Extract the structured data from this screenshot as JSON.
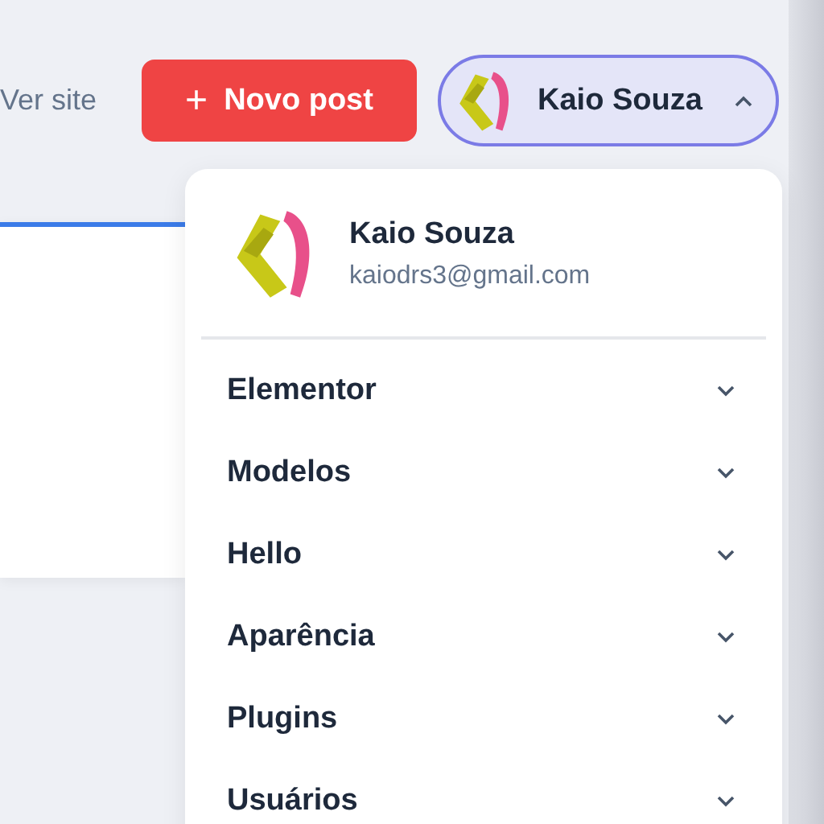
{
  "top_bar": {
    "view_site_link": "Ver site",
    "new_post_button": {
      "icon": "+",
      "label": "Novo post"
    },
    "user_menu": {
      "name": "Kaio Souza",
      "expanded": true
    }
  },
  "dropdown": {
    "user": {
      "name": "Kaio Souza",
      "email": "kaiodrs3@gmail.com"
    },
    "items": [
      {
        "label": "Elementor",
        "expanded": false
      },
      {
        "label": "Modelos",
        "expanded": false
      },
      {
        "label": "Hello",
        "expanded": false
      },
      {
        "label": "Aparência",
        "expanded": false
      },
      {
        "label": "Plugins",
        "expanded": false
      },
      {
        "label": "Usuários",
        "expanded": false
      }
    ]
  }
}
